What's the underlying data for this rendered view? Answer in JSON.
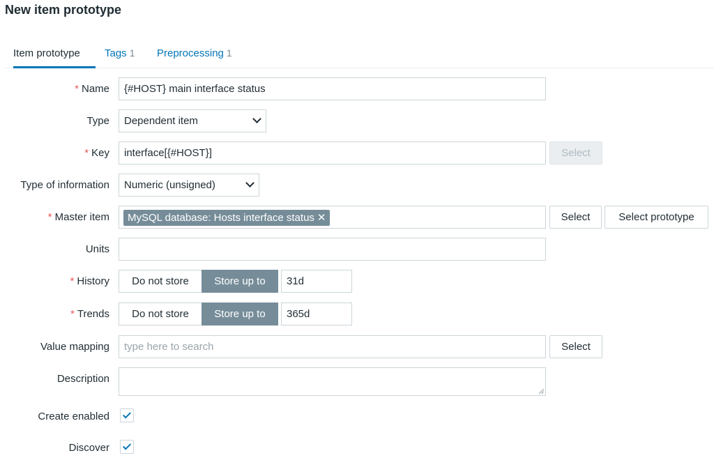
{
  "page": {
    "title": "New item prototype"
  },
  "tabs": [
    {
      "label": "Item prototype",
      "count": ""
    },
    {
      "label": "Tags",
      "count": "1"
    },
    {
      "label": "Preprocessing",
      "count": "1"
    }
  ],
  "form": {
    "name": {
      "label": "Name",
      "value": "{#HOST} main interface status"
    },
    "type": {
      "label": "Type",
      "value": "Dependent item"
    },
    "key": {
      "label": "Key",
      "value": "interface[{#HOST}]",
      "select_label": "Select"
    },
    "type_of_information": {
      "label": "Type of information",
      "value": "Numeric (unsigned)"
    },
    "master_item": {
      "label": "Master item",
      "chip": "MySQL database: Hosts interface status",
      "remove_symbol": "✕",
      "select_label": "Select",
      "select_prototype_label": "Select prototype"
    },
    "units": {
      "label": "Units",
      "value": ""
    },
    "history": {
      "label": "History",
      "option_off": "Do not store",
      "option_on": "Store up to",
      "value": "31d"
    },
    "trends": {
      "label": "Trends",
      "option_off": "Do not store",
      "option_on": "Store up to",
      "value": "365d"
    },
    "value_mapping": {
      "label": "Value mapping",
      "placeholder": "type here to search",
      "select_label": "Select"
    },
    "description": {
      "label": "Description",
      "value": ""
    },
    "create_enabled": {
      "label": "Create enabled",
      "checked": true
    },
    "discover": {
      "label": "Discover",
      "checked": true
    }
  },
  "required_mark": "*",
  "colors": {
    "accent": "#0275b8",
    "required": "#e45959",
    "toggle_on": "#768d99"
  }
}
